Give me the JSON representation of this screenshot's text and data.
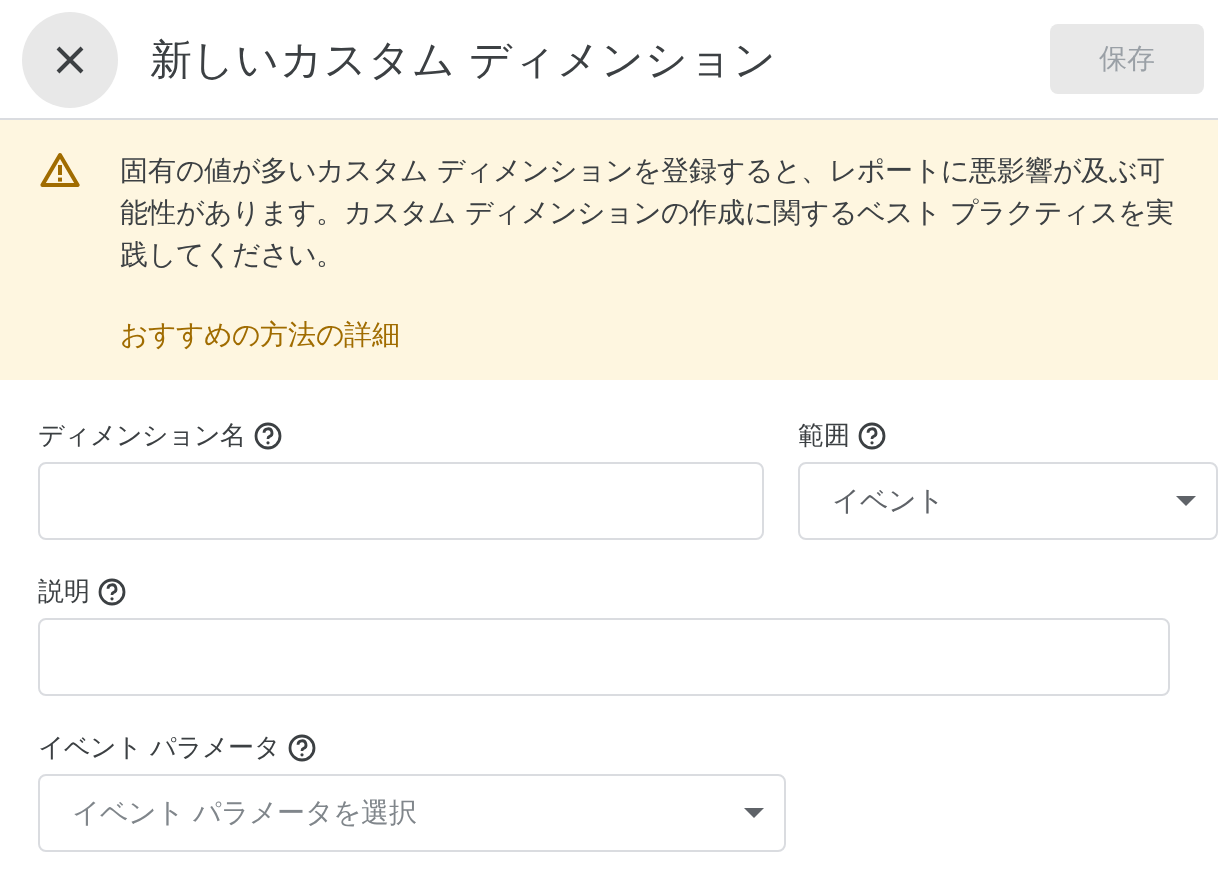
{
  "header": {
    "title": "新しいカスタム ディメンション",
    "save_button": {
      "label": "保存",
      "disabled": true
    }
  },
  "warning": {
    "message": "固有の値が多いカスタム ディメンションを登録すると、レポートに悪影響が及ぶ可能性があります。カスタム ディメンションの作成に関するベスト プラクティスを実践してください。",
    "link": "おすすめの方法の詳細"
  },
  "rows": [
    [
      {
        "kind": "text",
        "label": "ディメンション名"
      },
      {
        "kind": "select",
        "label": "範囲",
        "value": "イベント"
      }
    ],
    [
      {
        "kind": "text",
        "label": "説明"
      }
    ],
    [
      {
        "kind": "select",
        "label": "イベント パラメータ",
        "placeholder": "イベント パラメータを選択"
      }
    ]
  ]
}
